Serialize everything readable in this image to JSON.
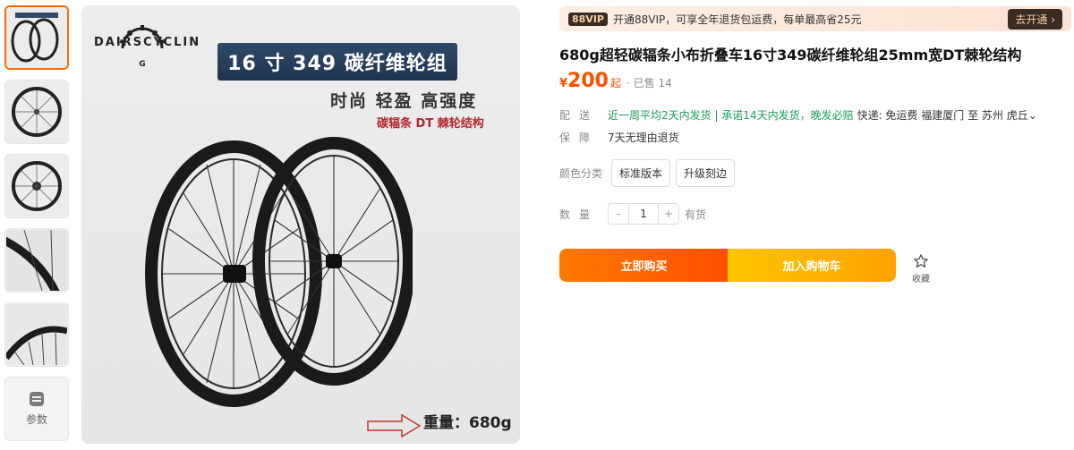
{
  "gallery": {
    "params_label": "参数"
  },
  "main_image": {
    "brand": "DAIRSCYCLIN",
    "banner": "16 寸 349 碳纤维轮组",
    "slogan": "时尚  轻盈  高强度",
    "sub_slogan": "碳辐条  DT 棘轮结构",
    "weight": "重量：680g"
  },
  "vip": {
    "badge": "88VIP",
    "text": "开通88VIP，可享全年退货包运费，每单最高省25元",
    "button": "去开通 ›"
  },
  "product": {
    "title": "680g超轻碳辐条小布折叠车16寸349碳纤维轮组25mm宽DT棘轮结构",
    "currency": "¥",
    "price": "200",
    "price_suffix": "起",
    "sold": "· 已售 14"
  },
  "shipping": {
    "label": "配送",
    "promise": "近一周平均2天内发货 | 承诺14天内发货，晚发必赔",
    "info": "快递: 免运费  福建厦门  至  苏州 虎丘⌄"
  },
  "guarantee": {
    "label": "保障",
    "text": "7天无理由退货"
  },
  "variants": {
    "label": "颜色分类",
    "options": [
      "标准版本",
      "升级刻边"
    ]
  },
  "quantity": {
    "label": "数量",
    "minus": "-",
    "value": "1",
    "plus": "+",
    "stock": "有货"
  },
  "actions": {
    "buy": "立即购买",
    "cart": "加入购物车",
    "favorite": "收藏"
  },
  "colors": {
    "accent": "#ff5000",
    "shipping_green": "#18a058",
    "banner_blue": "#1f344f"
  }
}
